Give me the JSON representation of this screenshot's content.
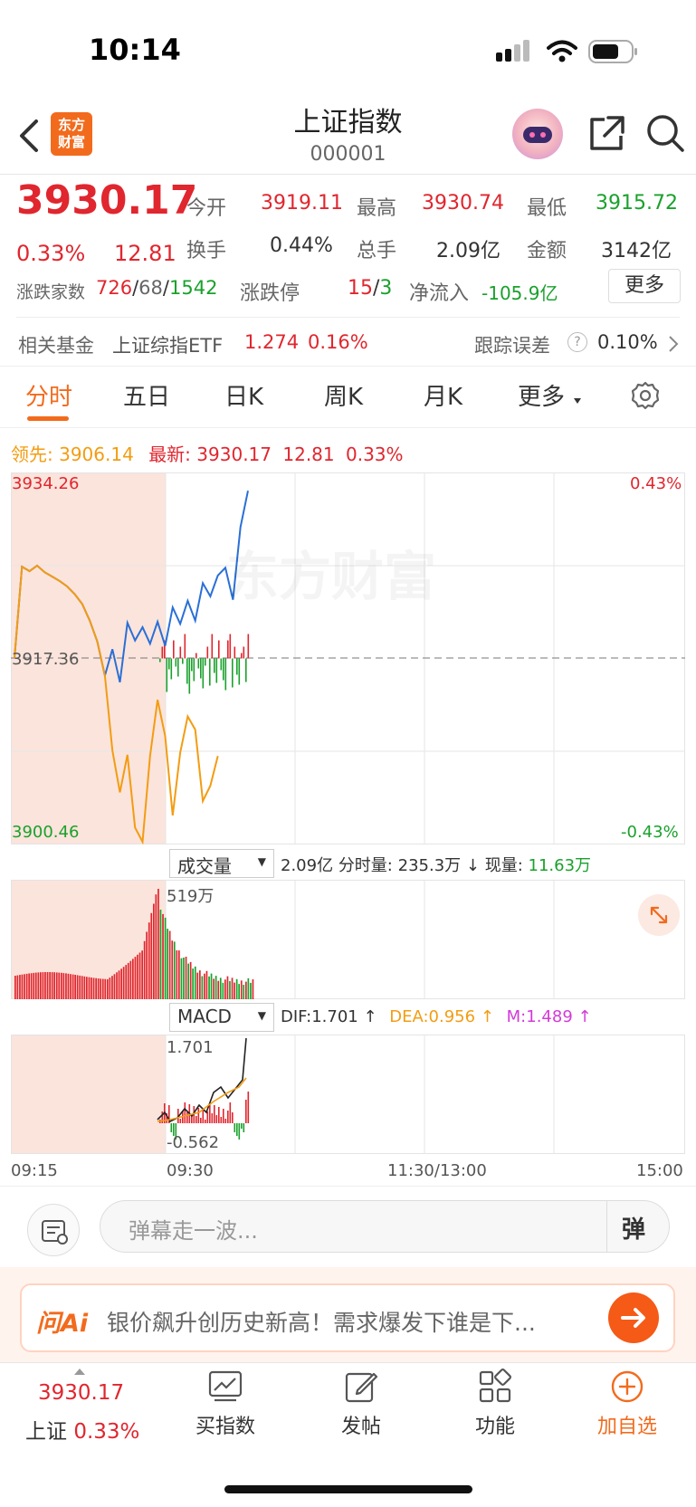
{
  "status_bar": {
    "time": "10:14"
  },
  "header": {
    "title": "上证指数",
    "code": "000001",
    "logo_text": "东方\n财富",
    "logo_line1": "东方",
    "logo_line2": "财富"
  },
  "quote": {
    "price": "3930.17",
    "change_pct": "0.33%",
    "change": "12.81",
    "open_label": "今开",
    "open": "3919.11",
    "high_label": "最高",
    "high": "3930.74",
    "low_label": "最低",
    "low": "3915.72",
    "turnover_label": "换手",
    "turnover": "0.44%",
    "volume_label": "总手",
    "volume": "2.09亿",
    "amount_label": "金额",
    "amount": "3142亿",
    "breadth_label": "涨跌家数",
    "breadth_up": "726",
    "breadth_sep1": "/",
    "breadth_flat": "68",
    "breadth_sep2": "/",
    "breadth_down": "1542",
    "limit_label": "涨跌停",
    "limit_up": "15",
    "limit_sep": "/",
    "limit_down": "3",
    "netflow_label": "净流入",
    "netflow": "-105.9亿",
    "more_label": "更多"
  },
  "fund": {
    "label": "相关基金",
    "name": "上证综指ETF",
    "price": "1.274",
    "pct": "0.16%",
    "tracking_label": "跟踪误差",
    "tracking_value": "0.10%"
  },
  "tabs": [
    {
      "label": "分时",
      "active": true
    },
    {
      "label": "五日",
      "active": false
    },
    {
      "label": "日K",
      "active": false
    },
    {
      "label": "周K",
      "active": false
    },
    {
      "label": "月K",
      "active": false
    },
    {
      "label": "更多",
      "active": false
    }
  ],
  "intraday": {
    "lead_label": "领先:",
    "lead_value": "3906.14",
    "latest_label": "最新:",
    "latest_value": "3930.17",
    "latest_change": "12.81",
    "latest_pct": "0.33%",
    "y_top": "3934.26",
    "y_mid": "3917.36",
    "y_bottom": "3900.46",
    "pct_top": "0.43%",
    "pct_bottom": "-0.43%",
    "watermark": "东方财富"
  },
  "volume_panel": {
    "selector": "成交量",
    "total": "2.09亿",
    "minute_label": "分时量:",
    "minute_value": "235.3万",
    "arrow": "↓",
    "current_label": "现量:",
    "current_value": "11.63万",
    "peak_label": "519万"
  },
  "macd_panel": {
    "selector": "MACD",
    "dif": "DIF:1.701 ↑",
    "dea": "DEA:0.956 ↑",
    "m": "M:1.489 ↑",
    "max_label": "1.701",
    "min_label": "-0.562"
  },
  "time_axis": [
    "09:15",
    "09:30",
    "11:30/13:00",
    "15:00"
  ],
  "comment": {
    "placeholder": "弹幕走一波...",
    "danmu_label": "弹"
  },
  "ai": {
    "brand": "问Ai",
    "text": "银价飙升创历史新高！需求爆发下谁是下..."
  },
  "bottom_bar": {
    "index_value": "3930.17",
    "index_name": "上证",
    "index_pct": "0.33%",
    "items": [
      {
        "label": "买指数",
        "icon": "chart-icon"
      },
      {
        "label": "发帖",
        "icon": "edit-icon"
      },
      {
        "label": "功能",
        "icon": "grid-icon"
      },
      {
        "label": "加自选",
        "icon": "plus-circle-icon"
      }
    ]
  },
  "colors": {
    "up": "#e0262e",
    "down": "#1aa12c",
    "accent": "#f26b1d",
    "price_line": "#2a6fd6",
    "avg_line": "#f39c12"
  },
  "chart_data": {
    "type": "line",
    "x_ticks": [
      "09:15",
      "09:30",
      "11:30/13:00",
      "15:00"
    ],
    "y_range": [
      3900.46,
      3934.26
    ],
    "prev_close": 3917.36,
    "series": [
      {
        "values": [
          3917.4,
          3925.7,
          3925.3,
          3925.8,
          3925.2,
          3924.8,
          3924.4,
          3923.9,
          3923.2,
          3922.3,
          3920.8,
          3918.9,
          3915.8,
          3918.2,
          3915.2,
          3920.6,
          3919.0,
          3920.2,
          3918.7,
          3920.7,
          3918.5,
          3922.0,
          3920.5,
          3922.6,
          3920.8,
          3924.2,
          3923.0,
          3924.9,
          3925.6,
          3922.7,
          3929.3,
          3932.6
        ]
      },
      {
        "values": [
          3917.4,
          3925.7,
          3925.3,
          3925.8,
          3925.2,
          3924.8,
          3924.4,
          3923.9,
          3923.2,
          3922.3,
          3920.8,
          3918.9,
          3915.8,
          3909.0,
          3905.2,
          3908.6,
          3902.0,
          3900.7,
          3908.5,
          3913.6,
          3910.3,
          3903.1,
          3908.8,
          3912.1,
          3910.9,
          3904.4,
          3905.8,
          3908.5
        ]
      }
    ]
  }
}
